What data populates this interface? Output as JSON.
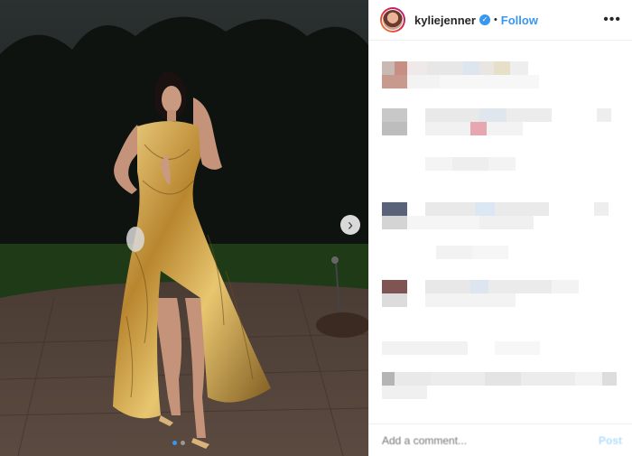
{
  "header": {
    "username": "kyliejenner",
    "verified_icon": "verified-badge-icon",
    "separator": "•",
    "follow_label": "Follow",
    "more_icon": "more-options-icon",
    "more_glyph": "•••"
  },
  "media": {
    "next_icon": "chevron-right-icon",
    "next_glyph": "›",
    "carousel_count": 2,
    "carousel_active": 1
  },
  "comments": {
    "blurred": true
  },
  "footer": {
    "comment_placeholder": "Add a comment...",
    "post_label": "Post"
  },
  "colors": {
    "accent": "#3897f0",
    "post_disabled": "#b2dffc"
  }
}
